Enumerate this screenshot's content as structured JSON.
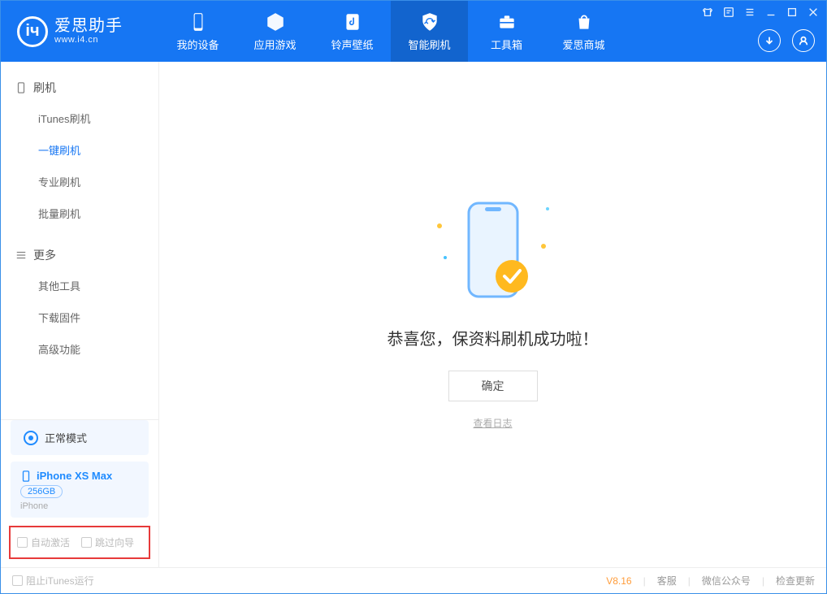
{
  "app": {
    "name": "爱思助手",
    "url": "www.i4.cn"
  },
  "top_tabs": [
    {
      "label": "我的设备"
    },
    {
      "label": "应用游戏"
    },
    {
      "label": "铃声壁纸"
    },
    {
      "label": "智能刷机"
    },
    {
      "label": "工具箱"
    },
    {
      "label": "爱思商城"
    }
  ],
  "active_top_tab": 3,
  "sidebar": {
    "groups": [
      {
        "title": "刷机",
        "items": [
          "iTunes刷机",
          "一键刷机",
          "专业刷机",
          "批量刷机"
        ],
        "selected": 1
      },
      {
        "title": "更多",
        "items": [
          "其他工具",
          "下载固件",
          "高级功能"
        ],
        "selected": -1
      }
    ]
  },
  "device": {
    "mode": "正常模式",
    "name": "iPhone XS Max",
    "capacity": "256GB",
    "type": "iPhone"
  },
  "options": {
    "auto_activate": "自动激活",
    "skip_guide": "跳过向导"
  },
  "main": {
    "success": "恭喜您，保资料刷机成功啦！",
    "ok": "确定",
    "view_log": "查看日志"
  },
  "status": {
    "block_itunes": "阻止iTunes运行",
    "version": "V8.16",
    "links": [
      "客服",
      "微信公众号",
      "检查更新"
    ]
  }
}
